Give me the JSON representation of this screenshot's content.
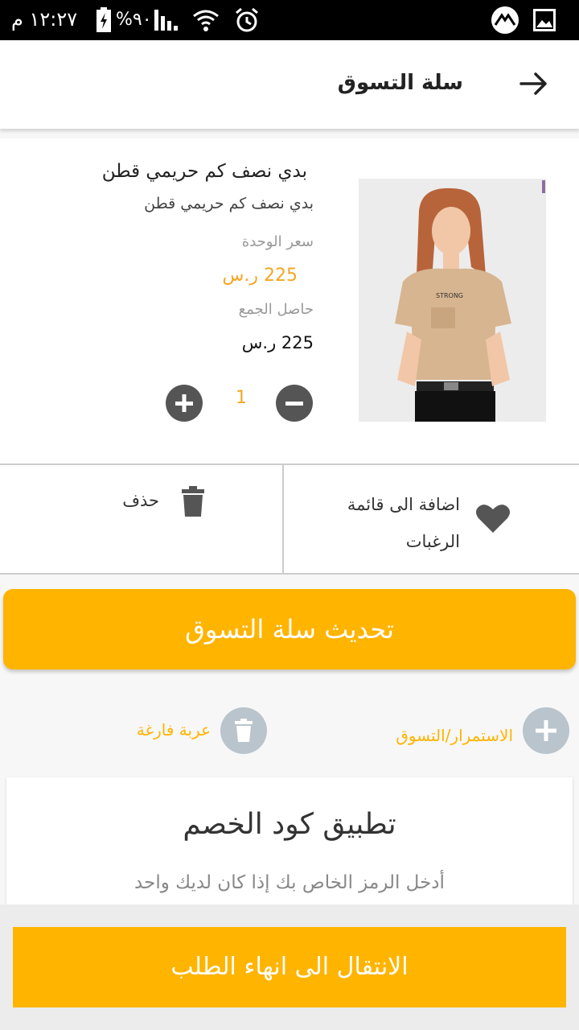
{
  "status_bar": {
    "time": "١٢:٢٧ م",
    "battery": "%٩٠",
    "icons": [
      "alarm-icon",
      "wifi-icon",
      "signal-icon",
      "battery-icon",
      "image-icon",
      "app-icon"
    ]
  },
  "app_bar": {
    "title": "سلة التسوق",
    "back_icon": "arrow-right-icon"
  },
  "cart_item": {
    "name": "بدي نصف كم حريمي قطن",
    "description": "بدي نصف كم حريمي قطن",
    "unit_price_label": "سعر الوحدة",
    "unit_price": "225 ر.س",
    "total_label": "حاصل الجمع",
    "total": "225 ر.س",
    "quantity": "1",
    "image_alt": "product-photo"
  },
  "actions": {
    "wishlist_label": "اضافة الى قائمة الرغبات",
    "delete_label": "حذف"
  },
  "update_button": "تحديث سلة التسوق",
  "links": {
    "continue_shopping": "الاستمرار/التسوق",
    "empty_cart": "عربة فارغة"
  },
  "coupon": {
    "title": "تطبيق كود الخصم",
    "subtitle": "أدخل الرمز الخاص بك إذا كان لديك واحد"
  },
  "checkout_button": "الانتقال الى انهاء الطلب",
  "colors": {
    "accent": "#ffb400",
    "price": "#f5a623",
    "icon_gray": "#555555"
  }
}
